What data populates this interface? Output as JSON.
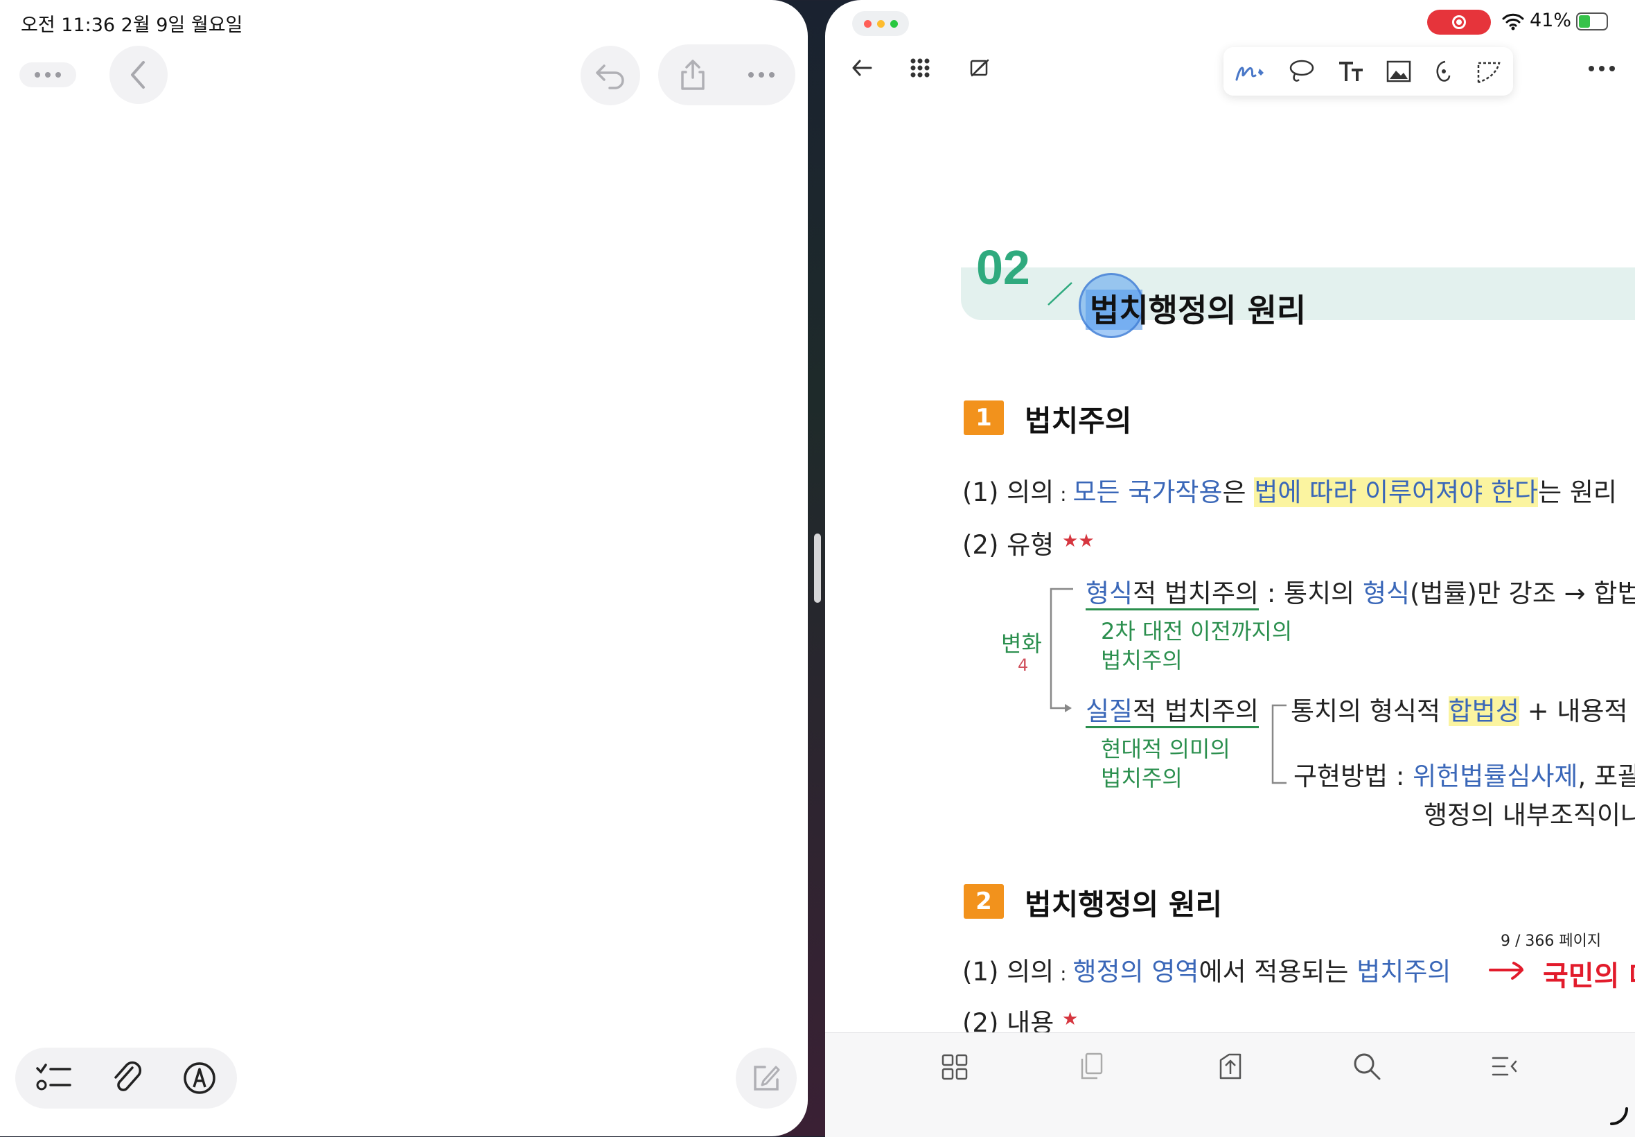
{
  "status_bar": {
    "time_date": "오전 11:36   2월 9일 월요일",
    "battery": "41%"
  },
  "left_pane": {
    "icons": [
      "more-icon",
      "back-chevron-icon",
      "undo-icon",
      "share-icon",
      "more-icon",
      "checklist-icon",
      "paperclip-icon",
      "markup-pen-icon",
      "compose-icon"
    ]
  },
  "right_pane": {
    "toolbar_icons": [
      "back-arrow-icon",
      "grid-icon",
      "pencil-slash-icon",
      "pen-tool-icon",
      "lasso-icon",
      "text-tool-icon",
      "image-icon",
      "eraser-icon",
      "shape-icon",
      "more-icon"
    ],
    "bottom_icons": [
      "thumbnail-grid-icon",
      "pages-icon",
      "export-icon",
      "search-icon",
      "outline-icon"
    ],
    "page_counter": "9 / 366 페이지"
  },
  "document": {
    "chapter_number": "02",
    "chapter_title": "법치행정의 원리",
    "section1": {
      "number": "1",
      "title": "법치주의",
      "meaning_prefix": "(1) 의의",
      "meaning_colon": " : ",
      "meaning_blue": "모든 국가작용",
      "meaning_mid": "은 ",
      "meaning_hl": "법에 따라 이루어져야 한다",
      "meaning_end": "는 원리",
      "types_label": "(2) 유형",
      "stars": "★★",
      "formal_blue": "형식",
      "formal_rest": "적 법치주의",
      "formal_desc_1": " : 통치의 ",
      "formal_desc_blue": "형식",
      "formal_desc_2": "(법률)만 강조 → 합법",
      "formal_note_1": "2차 대전 이전까지의",
      "formal_note_2": "법치주의",
      "substantive_blue": "실질",
      "substantive_rest": "적 법치주의",
      "substantive_desc_1": "통치의 형식적 ",
      "substantive_desc_hl": "합법성",
      "substantive_desc_2": " + 내용적",
      "substantive_note_1": "현대적 의미의",
      "substantive_note_2": "법치주의",
      "method_label": "구현방법 : ",
      "method_blue": "위헌법률심사제",
      "method_rest": ", 포괄",
      "method_line2": "행정의 내부조직이나",
      "change_note": "변화",
      "change_num": "4"
    },
    "section2": {
      "number": "2",
      "title": "법치행정의 원리",
      "meaning_prefix": "(1) 의의",
      "meaning_colon": " : ",
      "meaning_blue": "행정의 영역",
      "meaning_mid": "에서 적용되는 ",
      "meaning_blue2": "법치주의",
      "red_note": "국민의 대",
      "content_label": "(2) 내용",
      "star": "★"
    }
  }
}
